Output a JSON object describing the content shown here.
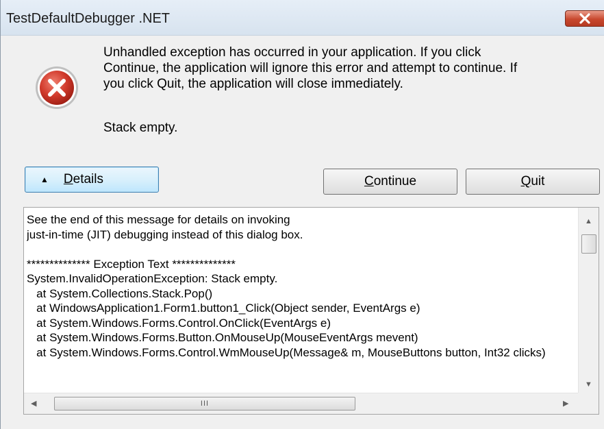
{
  "window": {
    "title": "TestDefaultDebugger .NET",
    "close_glyph": "✕"
  },
  "icon": {
    "name": "error-icon",
    "color": "#c8362a"
  },
  "message": {
    "text": "Unhandled exception has occurred in your application. If you click\nContinue, the application will ignore this error and attempt to continue. If\nyou click Quit, the application will close immediately.",
    "detail": "Stack empty."
  },
  "buttons": {
    "details_label": "Details",
    "details_arrow": "▲",
    "continue_label": "Continue",
    "quit_label": "Quit"
  },
  "details": {
    "lines": [
      "See the end of this message for details on invoking",
      "just-in-time (JIT) debugging instead of this dialog box.",
      "",
      "************** Exception Text **************",
      "System.InvalidOperationException: Stack empty.",
      "   at System.Collections.Stack.Pop()",
      "   at WindowsApplication1.Form1.button1_Click(Object sender, EventArgs e)",
      "   at System.Windows.Forms.Control.OnClick(EventArgs e)",
      "   at System.Windows.Forms.Button.OnMouseUp(MouseEventArgs mevent)",
      "   at System.Windows.Forms.Control.WmMouseUp(Message& m, MouseButtons button, Int32 clicks)"
    ]
  },
  "scrollbars": {
    "up_arrow": "▲",
    "down_arrow": "▼",
    "left_arrow": "◀",
    "right_arrow": "▶",
    "thumb_grip": "III"
  },
  "colors": {
    "accent": "#3c7fb1",
    "close_red": "#c8482e"
  }
}
